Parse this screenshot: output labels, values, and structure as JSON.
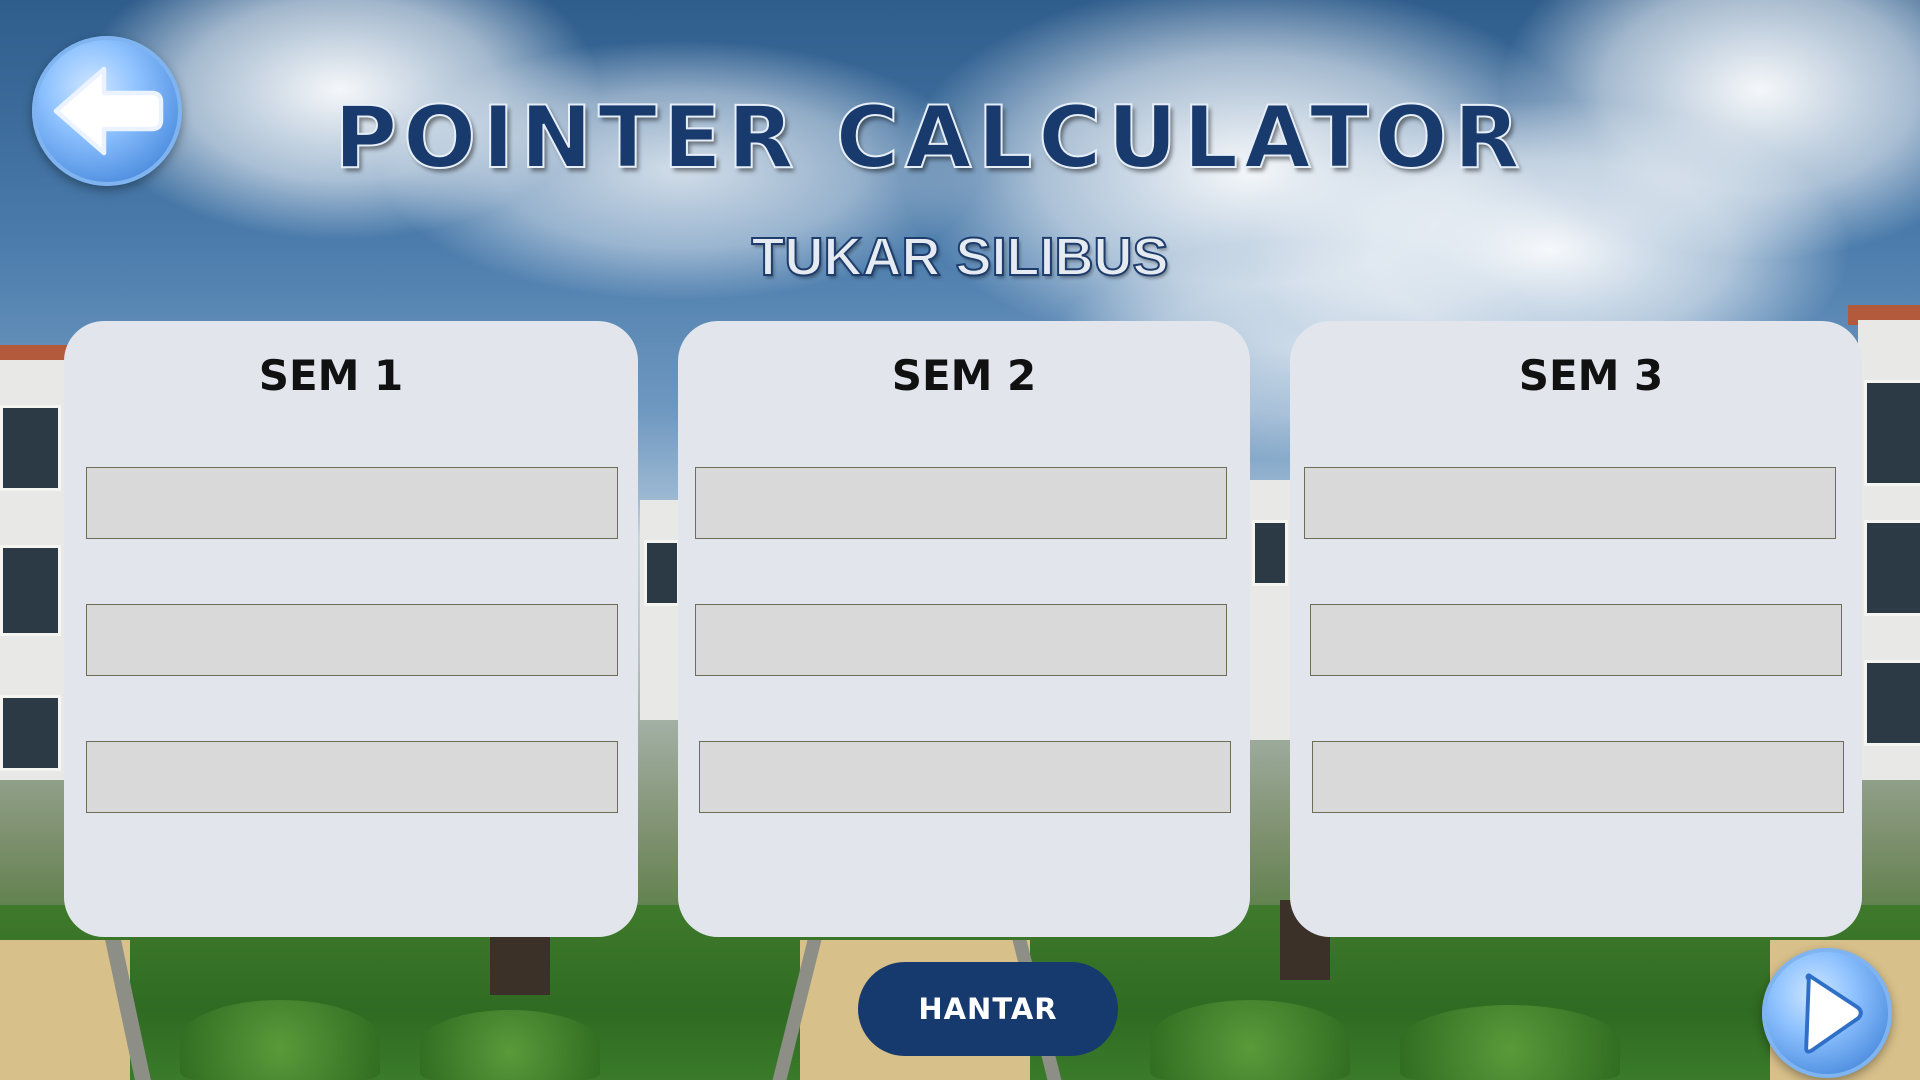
{
  "header": {
    "title": "POINTER CALCULATOR",
    "subtitle": "TUKAR SILIBUS"
  },
  "navigation": {
    "back_icon": "arrow-left-icon",
    "next_icon": "play-right-icon"
  },
  "semesters": [
    {
      "label": "SEM 1",
      "fields": [
        "",
        "",
        ""
      ]
    },
    {
      "label": "SEM 2",
      "fields": [
        "",
        "",
        ""
      ]
    },
    {
      "label": "SEM 3",
      "fields": [
        "",
        "",
        ""
      ]
    }
  ],
  "actions": {
    "submit_label": "HANTAR"
  },
  "colors": {
    "title": "#183a6c",
    "card": "#e2e6ec",
    "field": "#d9d9d9",
    "submit": "#163a6d",
    "nav_button": "#4f8fe0"
  }
}
